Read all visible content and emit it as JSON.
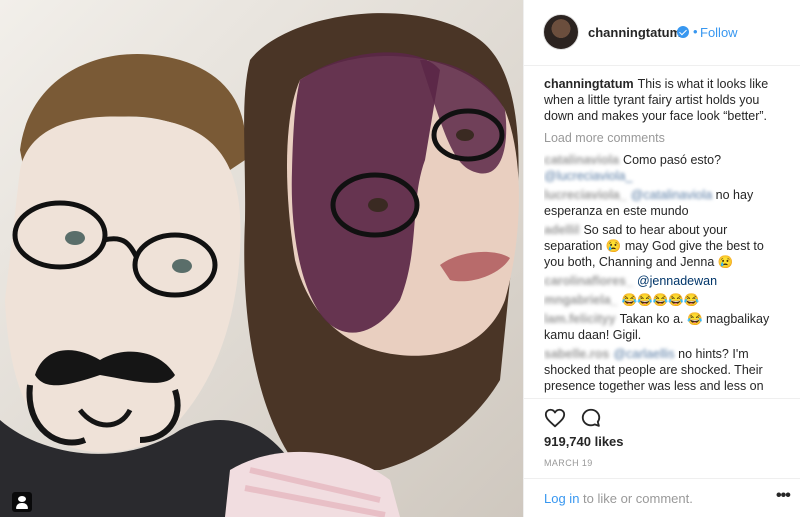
{
  "post": {
    "header": {
      "username": "channingtatum",
      "dot": "•",
      "follow_label": "Follow"
    },
    "caption": {
      "username": "channingtatum",
      "text": "This is what it looks like when a little tyrant fairy artist holds you down and makes your face look “better”."
    },
    "load_more_label": "Load more comments",
    "comments": [
      {
        "username": "catalinaviola",
        "text": "Como pasó esto?",
        "mention": "@lucreciaviola_"
      },
      {
        "username": "lucreciaviola_",
        "mention": "@catalinaviola",
        "text": "no hay esperanza en este mundo"
      },
      {
        "username": "adellil",
        "text": "So sad to hear about your separation 😢 may God give the best to you both, Channing and Jenna 😢"
      },
      {
        "username": "carolinaflores_",
        "mention": "@jennadewan"
      },
      {
        "username": "mngabriela_",
        "text": "😂😂😂😂😂"
      },
      {
        "username": "lam.felicityy",
        "text": "Takan ko a. 😂 magbalikay kamu daan! Gigil."
      },
      {
        "username": "sabelle.ros",
        "mention": "@carlaellis",
        "text": "no hints? I'm shocked that people are shocked. Their presence together was less and less on"
      }
    ],
    "likes": "919,740 likes",
    "date": "MARCH 19",
    "footer": {
      "login_link": "Log in",
      "login_rest": " to like or comment.",
      "more": "•••"
    }
  },
  "icons": {
    "like": "heart-outline-icon",
    "comment": "speech-bubble-icon",
    "verified": "verified-badge-icon",
    "user_tag": "user-tag-icon"
  },
  "colors": {
    "link_blue": "#3897f0",
    "muted_gray": "#999999",
    "text": "#262626",
    "divider": "#efefef"
  }
}
